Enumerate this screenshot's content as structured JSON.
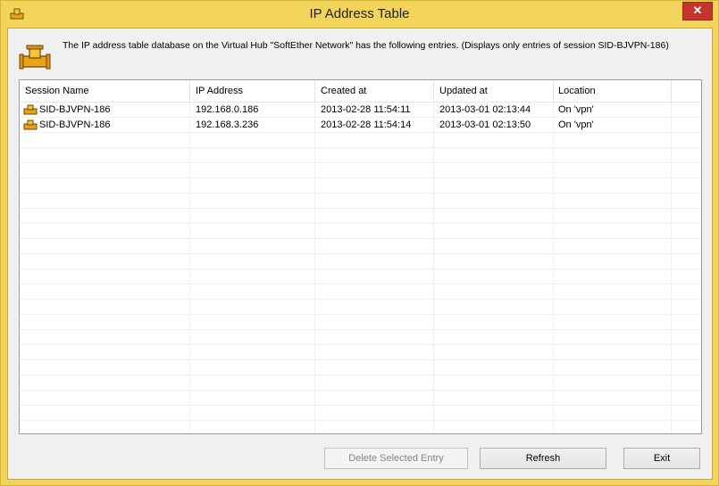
{
  "window": {
    "title": "IP Address Table",
    "close_glyph": "✕"
  },
  "description": "The IP address table database on the Virtual Hub \"SoftEther Network\" has the following entries. (Displays only entries of session SID-BJVPN-186)",
  "table": {
    "columns": [
      "Session Name",
      "IP Address",
      "Created at",
      "Updated at",
      "Location"
    ],
    "rows": [
      {
        "session": "SID-BJVPN-186",
        "ip": "192.168.0.186",
        "created": "2013-02-28 11:54:11",
        "updated": "2013-03-01 02:13:44",
        "location": "On 'vpn'"
      },
      {
        "session": "SID-BJVPN-186",
        "ip": "192.168.3.236",
        "created": "2013-02-28 11:54:14",
        "updated": "2013-03-01 02:13:50",
        "location": "On 'vpn'"
      }
    ]
  },
  "buttons": {
    "delete": "Delete Selected Entry",
    "refresh": "Refresh",
    "exit": "Exit"
  },
  "colors": {
    "frame": "#f3d45a",
    "close": "#c7342d"
  },
  "icons": {
    "app": "pipe-icon",
    "row": "session-pipe-icon"
  }
}
